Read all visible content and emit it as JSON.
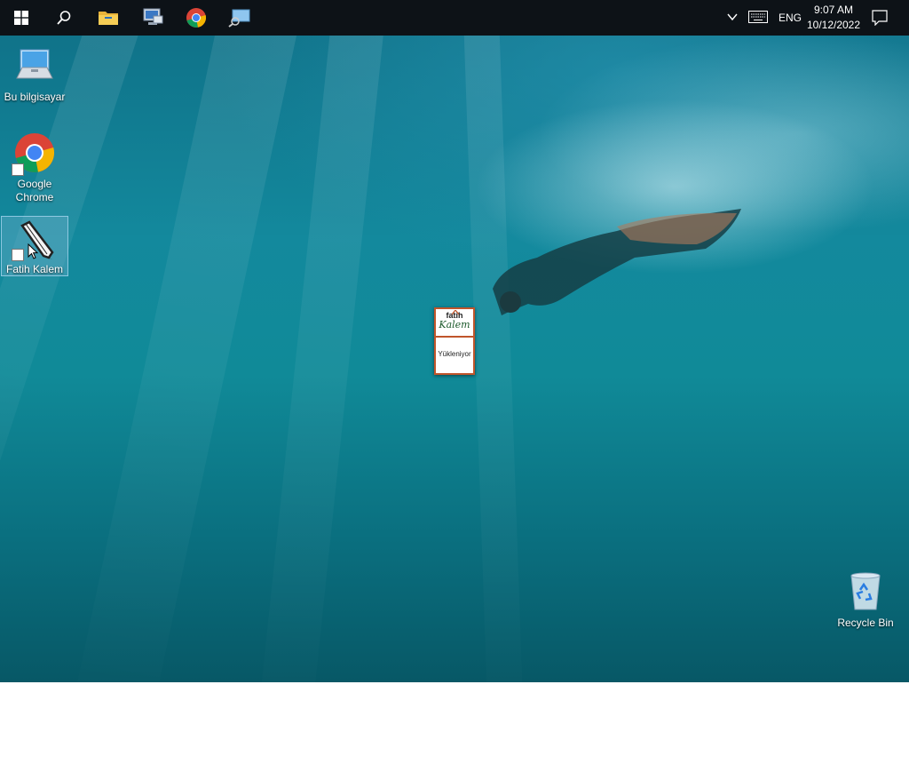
{
  "taskbar": {
    "pinned": [
      {
        "name": "start-button",
        "icon": "windows-logo-icon"
      },
      {
        "name": "search-button",
        "icon": "search-icon"
      },
      {
        "name": "file-explorer-button",
        "icon": "folder-icon"
      },
      {
        "name": "network-app-button",
        "icon": "computer-network-icon"
      },
      {
        "name": "chrome-taskbar-button",
        "icon": "chrome-icon"
      },
      {
        "name": "remote-app-button",
        "icon": "monitor-search-icon"
      }
    ],
    "tray": {
      "language": "ENG",
      "time": "9:07 AM",
      "date": "10/12/2022"
    }
  },
  "desktop": {
    "icons": [
      {
        "label": "Bu bilgisayar",
        "icon": "this-pc-icon"
      },
      {
        "label": "Google\nChrome",
        "icon": "chrome-icon"
      },
      {
        "label": "Fatih Kalem",
        "icon": "fatih-kalem-pen-icon",
        "selected": true
      },
      {
        "label": "Recycle Bin",
        "icon": "recycle-bin-icon"
      }
    ]
  },
  "splash": {
    "brand_top": "fatih",
    "brand_bottom": "Kalem",
    "status": "Yükleniyor"
  },
  "colors": {
    "taskbar": "#0d1217",
    "splash_border": "#c0552b",
    "water": "#108a98"
  }
}
